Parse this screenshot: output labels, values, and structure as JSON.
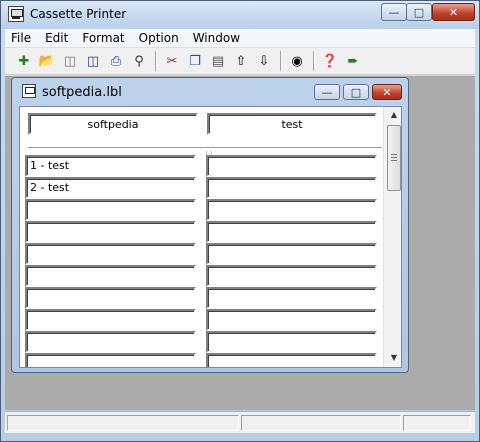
{
  "app": {
    "title": "Cassette Printer"
  },
  "menu": [
    "File",
    "Edit",
    "Format",
    "Option",
    "Window"
  ],
  "toolbar": {
    "buttons": [
      "new-icon",
      "open-icon",
      "save-icon",
      "save-as-icon",
      "print-icon",
      "print-preview-icon",
      "cut-icon",
      "copy-icon",
      "paste-icon",
      "move-up-icon",
      "move-down-icon",
      "cassette-icon",
      "help-icon",
      "exit-icon"
    ]
  },
  "document": {
    "title": "softpedia.lbl",
    "headers": [
      "softpedia",
      "test"
    ],
    "rows": [
      [
        "1 - test",
        ""
      ],
      [
        "2 - test",
        ""
      ],
      [
        "",
        ""
      ],
      [
        "",
        ""
      ],
      [
        "",
        ""
      ],
      [
        "",
        ""
      ],
      [
        "",
        ""
      ],
      [
        "",
        ""
      ],
      [
        "",
        ""
      ],
      [
        "",
        ""
      ]
    ]
  }
}
